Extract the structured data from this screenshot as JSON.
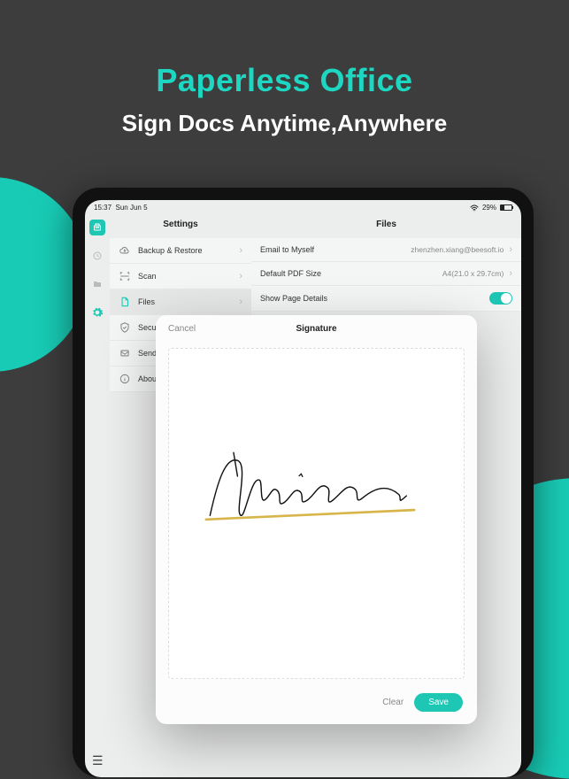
{
  "hero": {
    "title": "Paperless Office",
    "subtitle": "Sign Docs Anytime,Anywhere"
  },
  "statusbar": {
    "time": "15:37",
    "date": "Sun Jun 5",
    "battery_pct": "29%"
  },
  "panels": {
    "settings_title": "Settings",
    "files_title": "Files"
  },
  "settings_rows": {
    "backup": "Backup & Restore",
    "scan": "Scan",
    "files": "Files",
    "security": "Secu",
    "send": "Send",
    "about": "Abou"
  },
  "files_rows": {
    "email_label": "Email to Myself",
    "email_value": "zhenzhen.xiang@beesoft.io",
    "pdf_label": "Default PDF Size",
    "pdf_value": "A4(21.0 x 29.7cm)",
    "details_label": "Show Page Details"
  },
  "modal": {
    "cancel": "Cancel",
    "title": "Signature",
    "clear": "Clear",
    "save": "Save",
    "signature_text": "Signature"
  }
}
